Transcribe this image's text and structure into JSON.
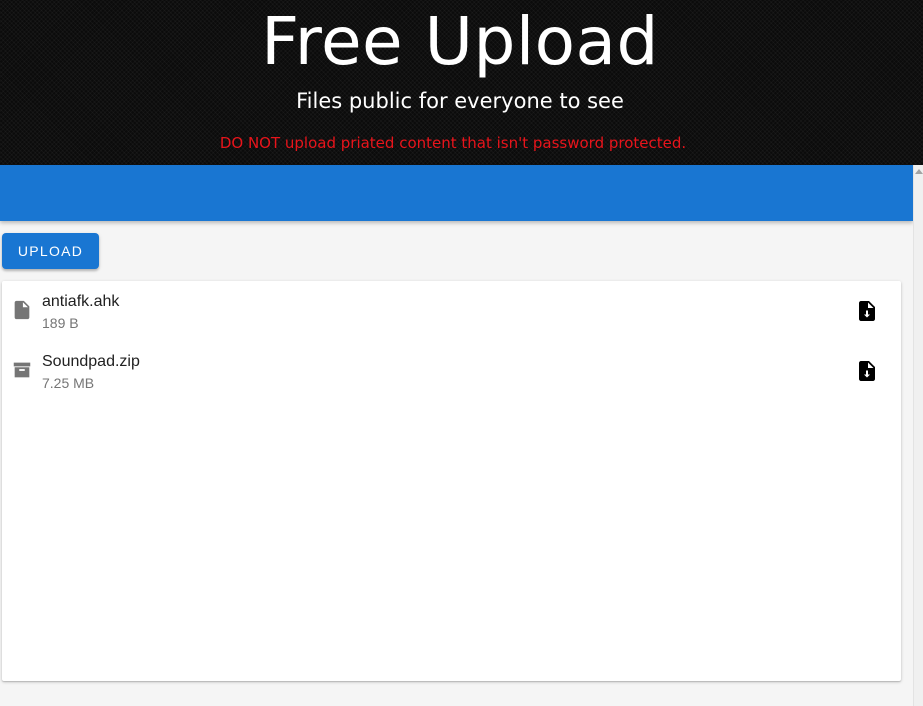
{
  "header": {
    "title": "Free Upload",
    "subtitle": "Files public for everyone to see",
    "warning": "DO NOT upload priated content that isn't password protected."
  },
  "toolbar": {
    "upload_label": "UPLOAD"
  },
  "files": [
    {
      "name": "antiafk.ahk",
      "size": "189 B",
      "icon": "file-icon"
    },
    {
      "name": "Soundpad.zip",
      "size": "7.25 MB",
      "icon": "archive-icon"
    }
  ],
  "colors": {
    "primary": "#1976d2",
    "warning": "#e8141b",
    "header_background": "#0b0b0b",
    "icon_gray": "#757575"
  },
  "icons": {
    "download": "file-download-icon"
  }
}
